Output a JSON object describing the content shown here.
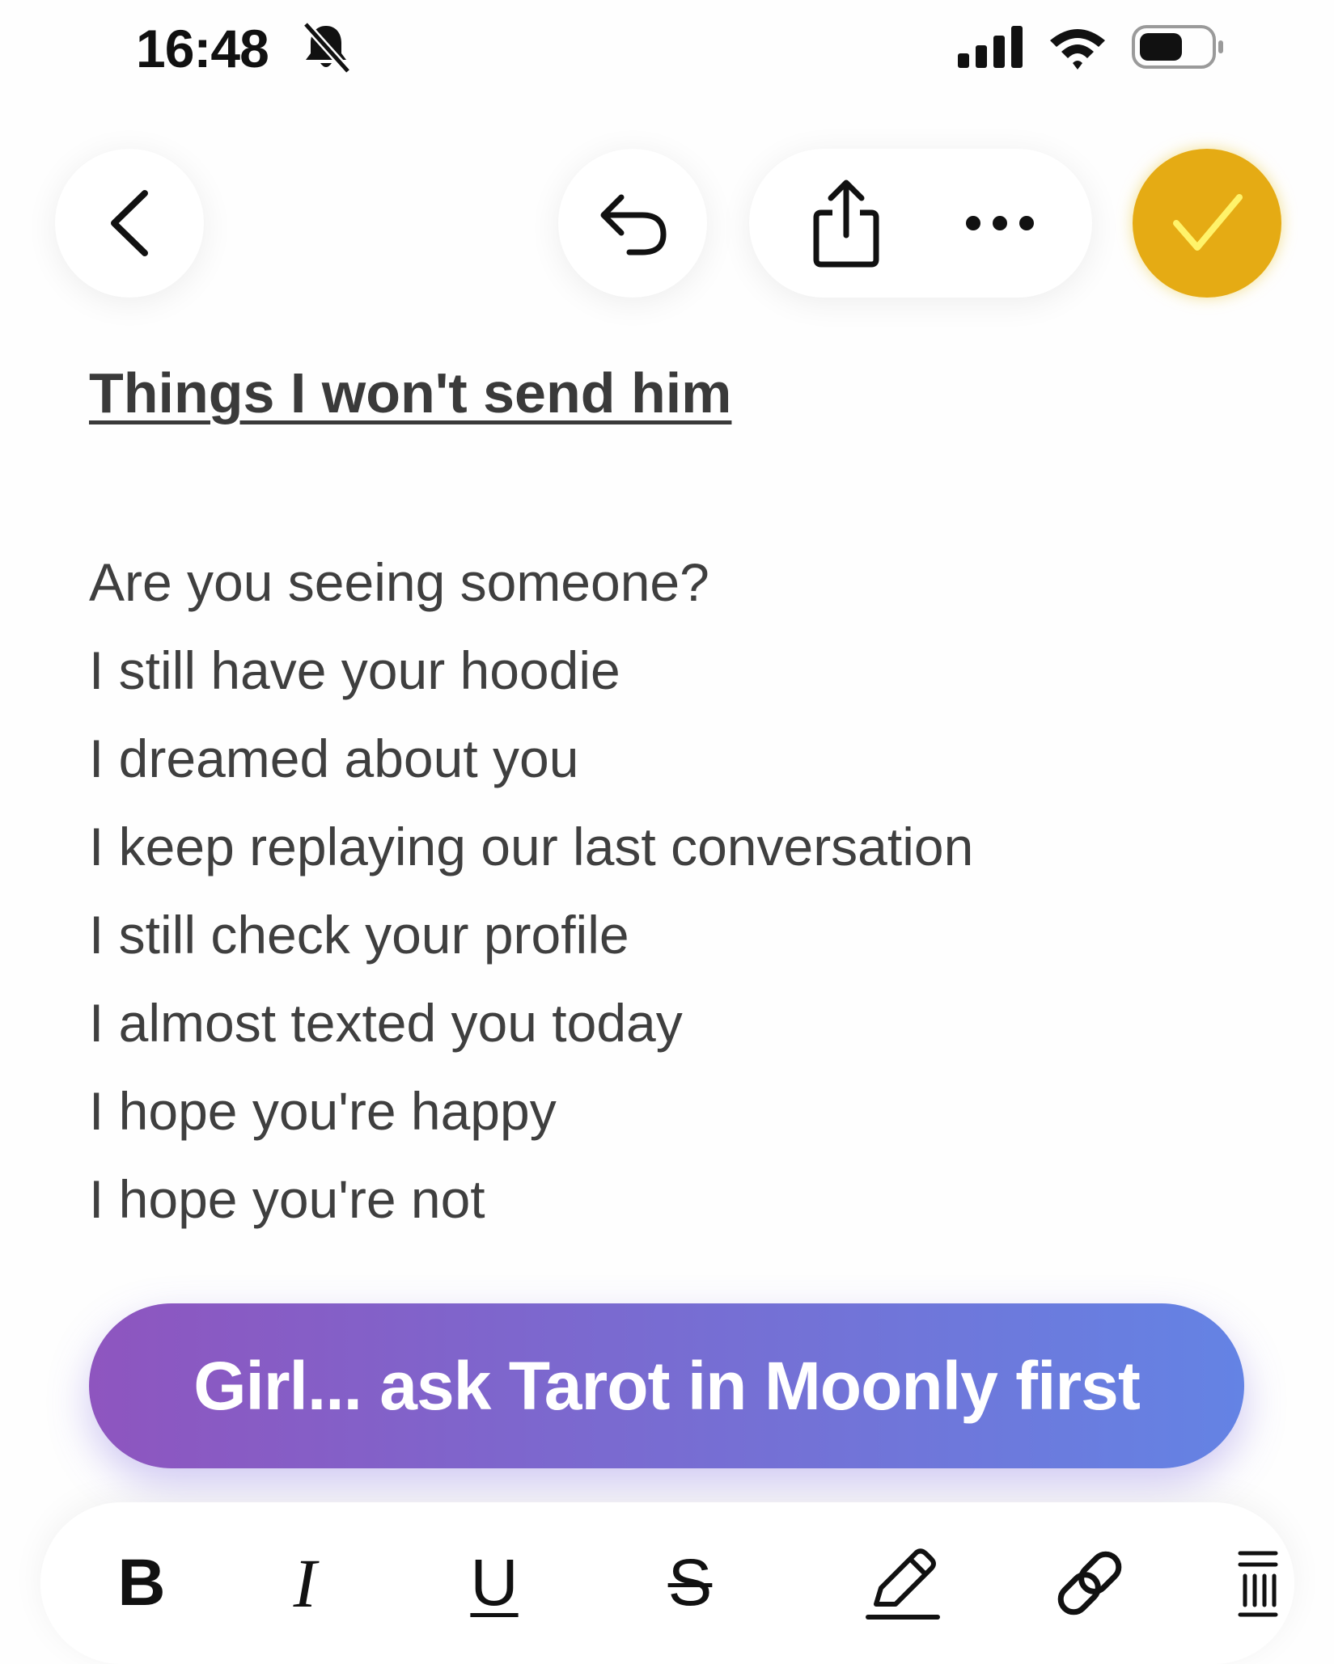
{
  "status_bar": {
    "time": "16:48",
    "icons": [
      "bell-slash-icon",
      "cellular-signal-icon",
      "wifi-icon",
      "battery-icon"
    ]
  },
  "toolbar": {
    "icons": [
      "chevron-left-icon",
      "undo-icon",
      "share-icon",
      "more-icon",
      "checkmark-icon"
    ],
    "done_color": "#e5ab14"
  },
  "note": {
    "title": "Things I won't send him",
    "lines": [
      "Are you seeing someone?",
      "I still have your hoodie",
      "I dreamed about you",
      "I keep replaying our last conversation",
      "I still check your profile",
      "I almost texted you today",
      "I hope you're happy",
      "I hope you're not"
    ]
  },
  "cta": {
    "label": "Girl... ask Tarot in Moonly first",
    "gradient": [
      "#8e55bf",
      "#6483e4"
    ]
  },
  "format_bar": {
    "bold": "B",
    "italic": "I",
    "underline": "U",
    "strikethrough": "S",
    "icons": [
      "highlighter-icon",
      "link-icon",
      "list-icon"
    ]
  }
}
